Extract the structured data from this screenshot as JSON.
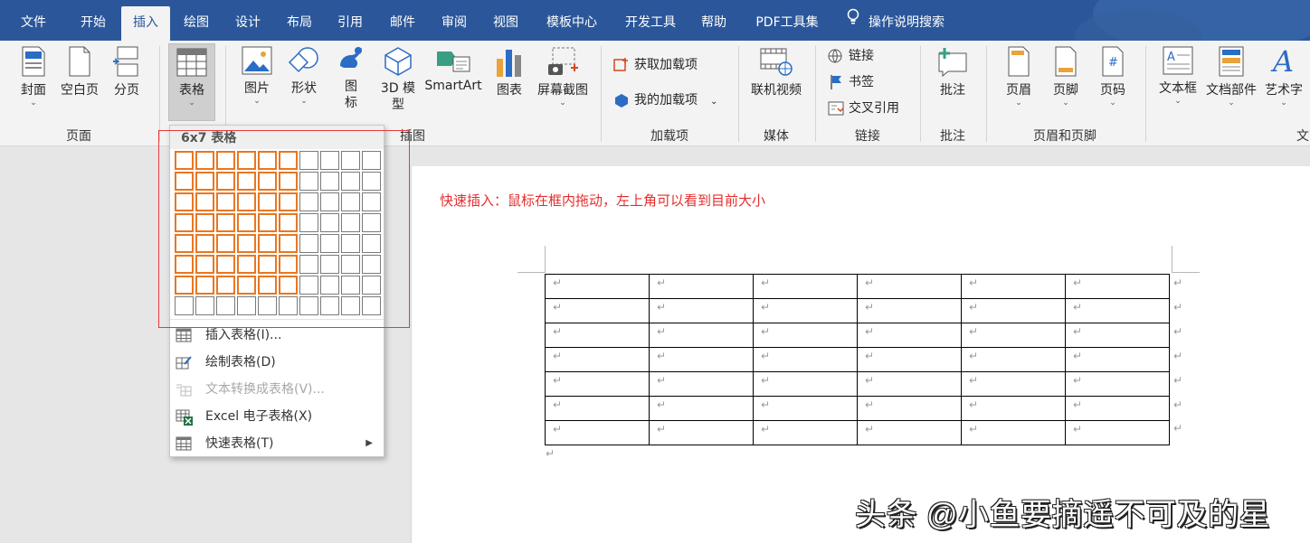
{
  "menu_tabs": [
    "文件",
    "开始",
    "插入",
    "绘图",
    "设计",
    "布局",
    "引用",
    "邮件",
    "审阅",
    "视图",
    "模板中心",
    "开发工具",
    "帮助",
    "PDF工具集"
  ],
  "search_label": "操作说明搜索",
  "ribbon": {
    "cover": "封面",
    "blank": "空白页",
    "pagebreak": "分页",
    "table": "表格",
    "picture": "图片",
    "shape": "形状",
    "icon1": "图",
    "icon2": "标",
    "model1": "3D 模",
    "model2": "型",
    "smartart": "SmartArt",
    "chart": "图表",
    "screenshot": "屏幕截图",
    "get_addins": "获取加载项",
    "my_addins": "我的加载项",
    "online_video": "联机视频",
    "link": "链接",
    "bookmark": "书签",
    "crossref": "交叉引用",
    "comment": "批注",
    "header": "页眉",
    "footer": "页脚",
    "pagenum": "页码",
    "textbox": "文本框",
    "quickparts": "文档部件",
    "wordart": "艺术字",
    "groups": {
      "pages": "页面",
      "tables": "表格",
      "illustrations": "插图",
      "addins": "加载项",
      "media": "媒体",
      "links": "链接",
      "comments": "批注",
      "headerfooter": "页眉和页脚",
      "text": "文"
    }
  },
  "dropdown": {
    "header": "6x7 表格",
    "grid_cols": 10,
    "grid_rows": 8,
    "selected_cols": 6,
    "selected_rows": 7,
    "items": [
      {
        "label": "插入表格(I)...",
        "enabled": true
      },
      {
        "label": "绘制表格(D)",
        "enabled": true
      },
      {
        "label": "文本转换成表格(V)...",
        "enabled": false
      },
      {
        "label": "Excel 电子表格(X)",
        "enabled": true
      },
      {
        "label": "快速表格(T)",
        "enabled": true
      }
    ]
  },
  "document": {
    "note": "快速插入：鼠标在框内拖动，左上角可以看到目前大小",
    "table_cols": 6,
    "table_rows": 7,
    "cell_mark": "↵"
  },
  "watermark": "头条 @小鱼要摘遥不可及的星",
  "colors": {
    "titlebar": "#2b579a",
    "ribbon": "#f3f3f3",
    "highlight": "#e87722",
    "note": "#e52d2d"
  }
}
